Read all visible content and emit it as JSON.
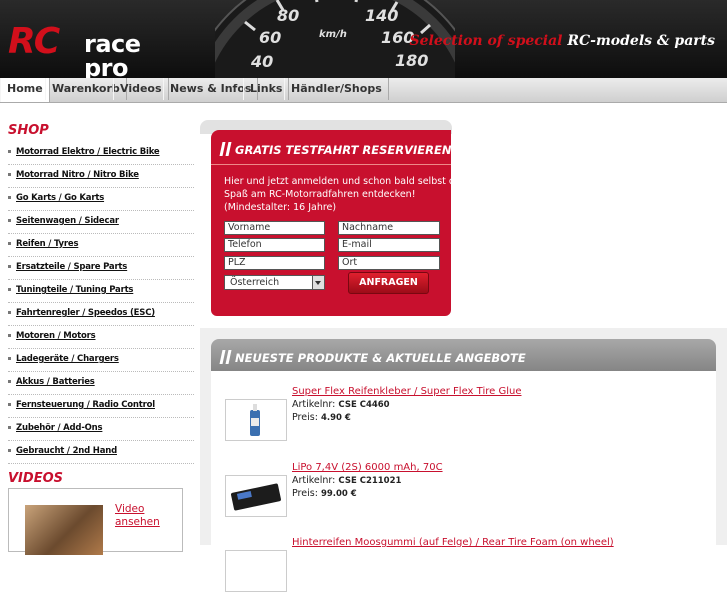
{
  "header": {
    "logo_rc": "RC",
    "logo_text": "race pro",
    "tagline_a": "Selection of special ",
    "tagline_b": "RC-models & parts",
    "gauge": {
      "n80": "80",
      "n140": "140",
      "n60": "60",
      "unit": "km/h",
      "n160": "160",
      "n40": "40",
      "n180": "180"
    }
  },
  "nav": {
    "items": [
      {
        "label": "Home"
      },
      {
        "label": "Warenkorb"
      },
      {
        "label": "Videos"
      },
      {
        "label": "News & Infos"
      },
      {
        "label": "Links"
      },
      {
        "label": "Händler/Shops"
      }
    ]
  },
  "sidebar": {
    "shop_title": "SHOP",
    "items": [
      {
        "label": "Motorrad Elektro / Electric Bike"
      },
      {
        "label": "Motorrad Nitro / Nitro Bike"
      },
      {
        "label": "Go Karts / Go Karts"
      },
      {
        "label": "Seitenwagen / Sidecar"
      },
      {
        "label": "Reifen / Tyres"
      },
      {
        "label": "Ersatzteile / Spare Parts"
      },
      {
        "label": "Tuningteile / Tuning Parts"
      },
      {
        "label": "Fahrtenregler / Speedos (ESC)"
      },
      {
        "label": "Motoren / Motors"
      },
      {
        "label": "Ladegeräte / Chargers"
      },
      {
        "label": "Akkus / Batteries"
      },
      {
        "label": "Fernsteuerung / Radio Control"
      },
      {
        "label": "Zubehör / Add-Ons"
      },
      {
        "label": "Gebraucht / 2nd Hand"
      }
    ],
    "videos_title": "VIDEOS",
    "video_link": "Video ansehen"
  },
  "test_ride": {
    "title": "GRATIS TESTFAHRT RESERVIEREN!",
    "text": "Hier und jetzt anmelden und schon bald selbst d Spaß am RC-Motorradfahren entdecken! (Mindestalter: 16 Jahre)",
    "fields": {
      "vorname": "Vorname",
      "nachname": "Nachname",
      "telefon": "Telefon",
      "email": "E-mail",
      "plz": "PLZ",
      "ort": "Ort"
    },
    "country": "Österreich",
    "button": "ANFRAGEN"
  },
  "products": {
    "title": "NEUESTE PRODUKTE & AKTUELLE ANGEBOTE",
    "art_label": "Artikelnr:",
    "price_label": "Preis:",
    "items": [
      {
        "name": "Super Flex Reifenkleber / Super Flex Tire Glue ",
        "art": "CSE C4460",
        "price": "4.90 €"
      },
      {
        "name": "LiPo 7,4V (2S) 6000 mAh, 70C ",
        "art": "CSE C211021",
        "price": "99.00 €"
      },
      {
        "name": "Hinterreifen Moosgummi (auf Felge) / Rear Tire Foam (on wheel)"
      }
    ]
  }
}
